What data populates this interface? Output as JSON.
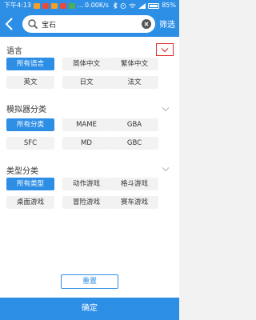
{
  "status": {
    "time": "下午4:13",
    "network": "0.00K/s",
    "battery": "85%"
  },
  "toolbar": {
    "search_value": "宝石",
    "filter_label": "筛选"
  },
  "language": {
    "title": "语言",
    "options": [
      "所有语言",
      "简体中文",
      "繁体中文",
      "英文",
      "日文",
      "法文"
    ]
  },
  "emulator": {
    "title": "模拟器分类",
    "options": [
      "所有分类",
      "MAME",
      "GBA",
      "SFC",
      "MD",
      "GBC"
    ]
  },
  "type": {
    "title": "类型分类",
    "options": [
      "所有类型",
      "动作游戏",
      "格斗游戏",
      "桌面游戏",
      "冒险游戏",
      "赛车游戏"
    ]
  },
  "buttons": {
    "reset": "重置",
    "confirm": "确定"
  },
  "colors": {
    "accent": "#2d8ee6",
    "highlight": "#e0302a"
  }
}
